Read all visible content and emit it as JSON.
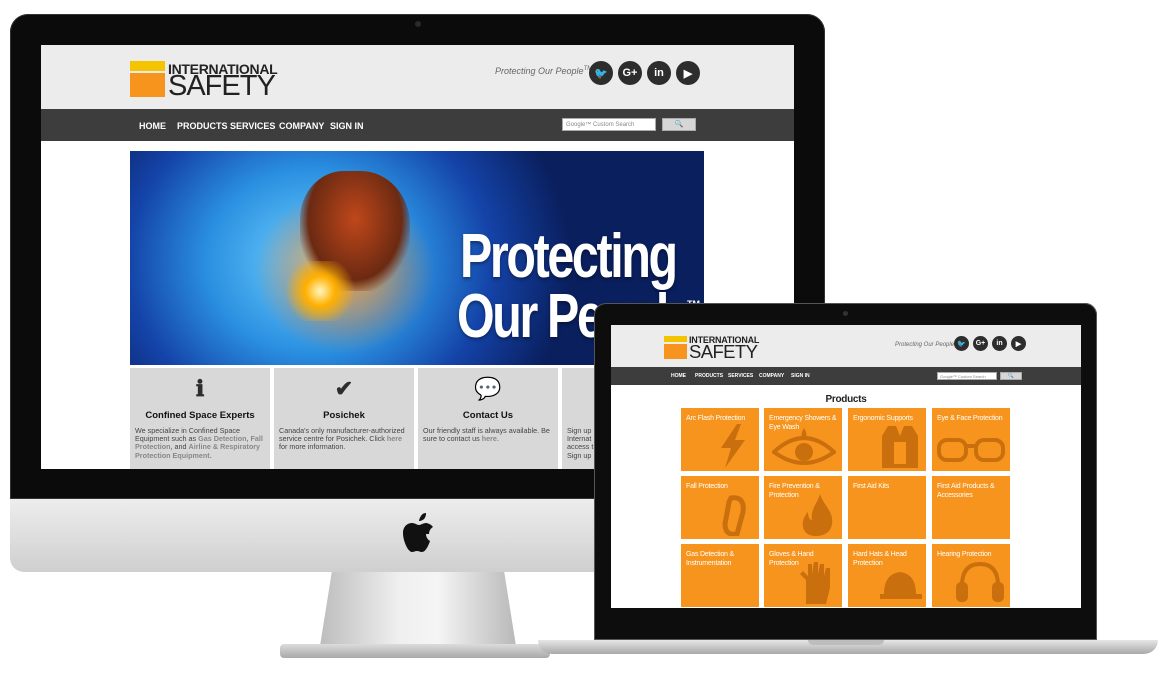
{
  "site": {
    "logo_line1": "INTERNATIONAL",
    "logo_line2": "SAFETY",
    "tagline": "Protecting Our People",
    "tagline_tm": "TM",
    "social": [
      {
        "icon": "twitter-icon",
        "glyph": "🐦"
      },
      {
        "icon": "google-plus-icon",
        "glyph": "G+"
      },
      {
        "icon": "linkedin-icon",
        "glyph": "in"
      },
      {
        "icon": "youtube-icon",
        "glyph": "▶"
      }
    ],
    "nav": [
      "HOME",
      "PRODUCTS",
      "SERVICES",
      "COMPANY",
      "SIGN IN"
    ],
    "search_placeholder": "Google™ Custom Search",
    "search_button": "🔍",
    "brand_colors": {
      "orange": "#f7941d",
      "yellow": "#f5c400",
      "nav": "#3d3d3d"
    }
  },
  "desktop": {
    "hero_line1": "Protecting",
    "hero_line2": "Our People",
    "hero_tm": "TM",
    "cards": [
      {
        "icon": "info-icon",
        "glyph": "ℹ",
        "title": "Confined Space Experts",
        "text_before": "We specialize in Confined Space Equipment such as ",
        "link1": "Gas Detection, Fall Protection,",
        "text_mid": " and ",
        "link2": "Airline & Respiratory Protection Equipment."
      },
      {
        "icon": "checkmark-icon",
        "glyph": "✔",
        "title": "Posichek",
        "text_before": "Canada's only manufacturer-authorized service centre for Posichek. Click ",
        "link1": "here",
        "text_mid": " for more information.",
        "link2": ""
      },
      {
        "icon": "chat-bubbles-icon",
        "glyph": "💬",
        "title": "Contact Us",
        "text_before": "Our friendly staff is always available. Be sure to contact us ",
        "link1": "here",
        "text_mid": ".",
        "link2": ""
      },
      {
        "icon": "",
        "glyph": "",
        "title": "",
        "text_before": "Sign up Internat access t Sign up",
        "link1": "",
        "text_mid": "",
        "link2": ""
      }
    ]
  },
  "laptop": {
    "page_title": "Products",
    "products": [
      {
        "label": "Arc Flash Protection",
        "icon": "lightning-icon"
      },
      {
        "label": "Emergency Showers & Eye Wash",
        "icon": "eye-icon"
      },
      {
        "label": "Ergonomic Supports",
        "icon": "safety-vest-icon"
      },
      {
        "label": "Eye & Face Protection",
        "icon": "safety-glasses-icon"
      },
      {
        "label": "Fall Protection",
        "icon": "carabiner-icon"
      },
      {
        "label": "Fire Prevention & Protection",
        "icon": "fire-icon"
      },
      {
        "label": "First Aid Kits",
        "icon": "first-aid-icon"
      },
      {
        "label": "First Aid Products & Accessories",
        "icon": "first-aid-products-icon"
      },
      {
        "label": "Gas Detection & Instrumentation",
        "icon": "gas-detector-icon"
      },
      {
        "label": "Gloves & Hand Protection",
        "icon": "glove-icon"
      },
      {
        "label": "Hard Hats & Head Protection",
        "icon": "hard-hat-icon"
      },
      {
        "label": "Hearing Protection",
        "icon": "ear-muffs-icon"
      }
    ]
  }
}
